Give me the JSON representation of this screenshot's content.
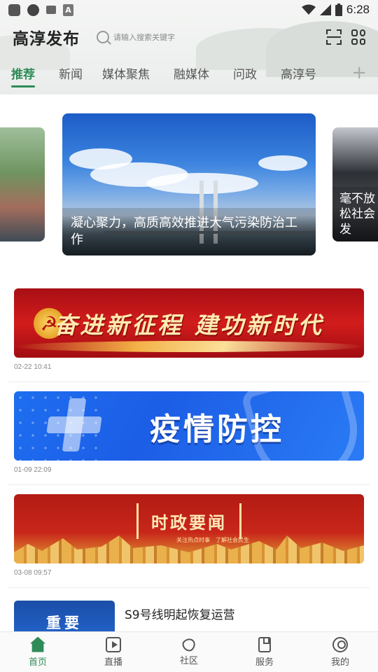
{
  "status_bar": {
    "time": "6:28"
  },
  "header": {
    "app_title": "高淳发布",
    "search_placeholder": "请输入搜索关键字"
  },
  "tabs": [
    {
      "label": "推荐",
      "active": true
    },
    {
      "label": "新闻",
      "active": false
    },
    {
      "label": "媒体聚焦",
      "active": false
    },
    {
      "label": "融媒体",
      "active": false
    },
    {
      "label": "问政",
      "active": false
    },
    {
      "label": "高淳号",
      "active": false
    }
  ],
  "add_tab_symbol": "+",
  "carousel": {
    "main_caption": "凝心聚力，高质高效推进大气污染防治工作",
    "right_caption": "毫不放松社会发"
  },
  "feed": [
    {
      "banner_text": "奋进新征程 建功新时代",
      "time": "02-22 10:41"
    },
    {
      "banner_text": "疫情防控",
      "time": "01-09 22:09"
    },
    {
      "banner_text": "时政要闻",
      "banner_sub": "关注热点时事　了解社会民生",
      "time": "03-08 09:57"
    }
  ],
  "news_row": {
    "thumb_text": "重要",
    "title": "S9号线明起恢复运营"
  },
  "bottom_nav": [
    {
      "label": "首页",
      "icon": "home-icon",
      "active": true
    },
    {
      "label": "直播",
      "icon": "live-icon",
      "active": false
    },
    {
      "label": "社区",
      "icon": "community-icon",
      "active": false
    },
    {
      "label": "服务",
      "icon": "service-icon",
      "active": false
    },
    {
      "label": "我的",
      "icon": "profile-icon",
      "active": false
    }
  ],
  "colors": {
    "accent": "#2e8b57",
    "banner_red": "#d21c1c",
    "banner_blue": "#1e6ef0"
  }
}
